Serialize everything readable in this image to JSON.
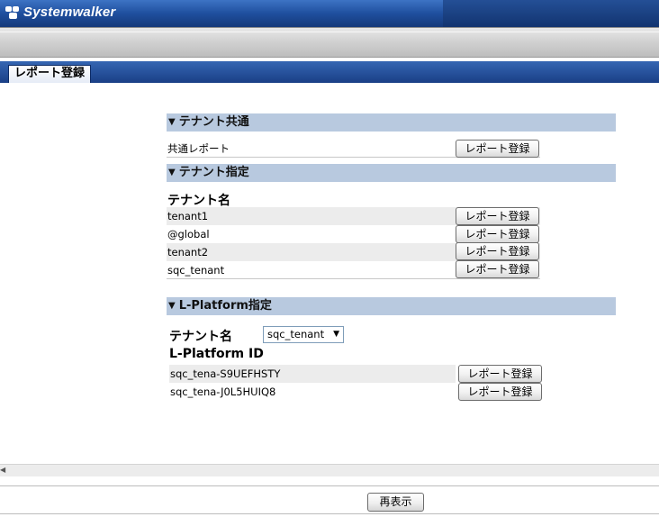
{
  "header": {
    "logo_text": "Systemwalker",
    "logo_icon": "systemwalker-logo-icon"
  },
  "tabs": [
    {
      "label": "レポート登録",
      "active": true
    }
  ],
  "tenant_common": {
    "heading": "テナント共通",
    "rows": [
      {
        "label": "共通レポート",
        "button": "レポート登録"
      }
    ]
  },
  "tenant_specified": {
    "heading": "テナント指定",
    "column_header": "テナント名",
    "rows": [
      {
        "label": "tenant1",
        "button": "レポート登録"
      },
      {
        "label": "@global",
        "button": "レポート登録"
      },
      {
        "label": "tenant2",
        "button": "レポート登録"
      },
      {
        "label": "sqc_tenant",
        "button": "レポート登録"
      }
    ]
  },
  "lplatform": {
    "heading": "L-Platform指定",
    "tenant_label": "テナント名",
    "tenant_select_value": "sqc_tenant",
    "column_header": "L-Platform ID",
    "rows": [
      {
        "label": "sqc_tena-S9UEFHSTY",
        "button": "レポート登録"
      },
      {
        "label": "sqc_tena-J0L5HUIQ8",
        "button": "レポート登録"
      }
    ]
  },
  "footer": {
    "refresh_button": "再表示"
  },
  "colors": {
    "header_blue": "#1f4f9e",
    "section_head": "#b8c9df",
    "row_shade": "#ececec"
  }
}
